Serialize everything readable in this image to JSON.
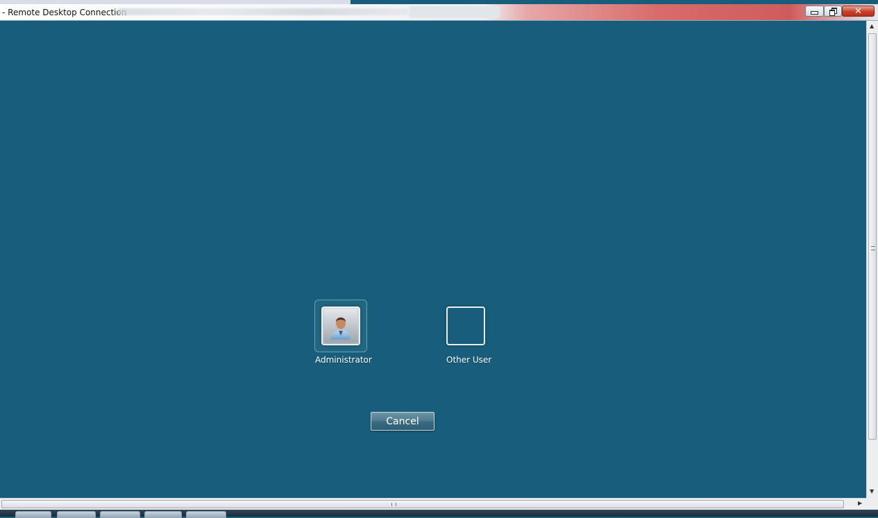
{
  "window": {
    "title": "- Remote Desktop Connection",
    "minimize_symbol": "",
    "close_symbol": "✕"
  },
  "login": {
    "users": [
      {
        "label": "Administrator",
        "icon": "user-avatar-icon",
        "selected": true
      },
      {
        "label": "Other User",
        "icon": "blank-avatar-icon",
        "selected": false
      }
    ],
    "cancel_label": "Cancel"
  },
  "scrollbars": {
    "up_arrow": "▲",
    "down_arrow": "▼",
    "right_arrow": "▶"
  },
  "colors": {
    "desktop_background": "#185e7c",
    "button_gradient_top": "#6f95a6",
    "button_gradient_bottom": "#2f5f75"
  }
}
